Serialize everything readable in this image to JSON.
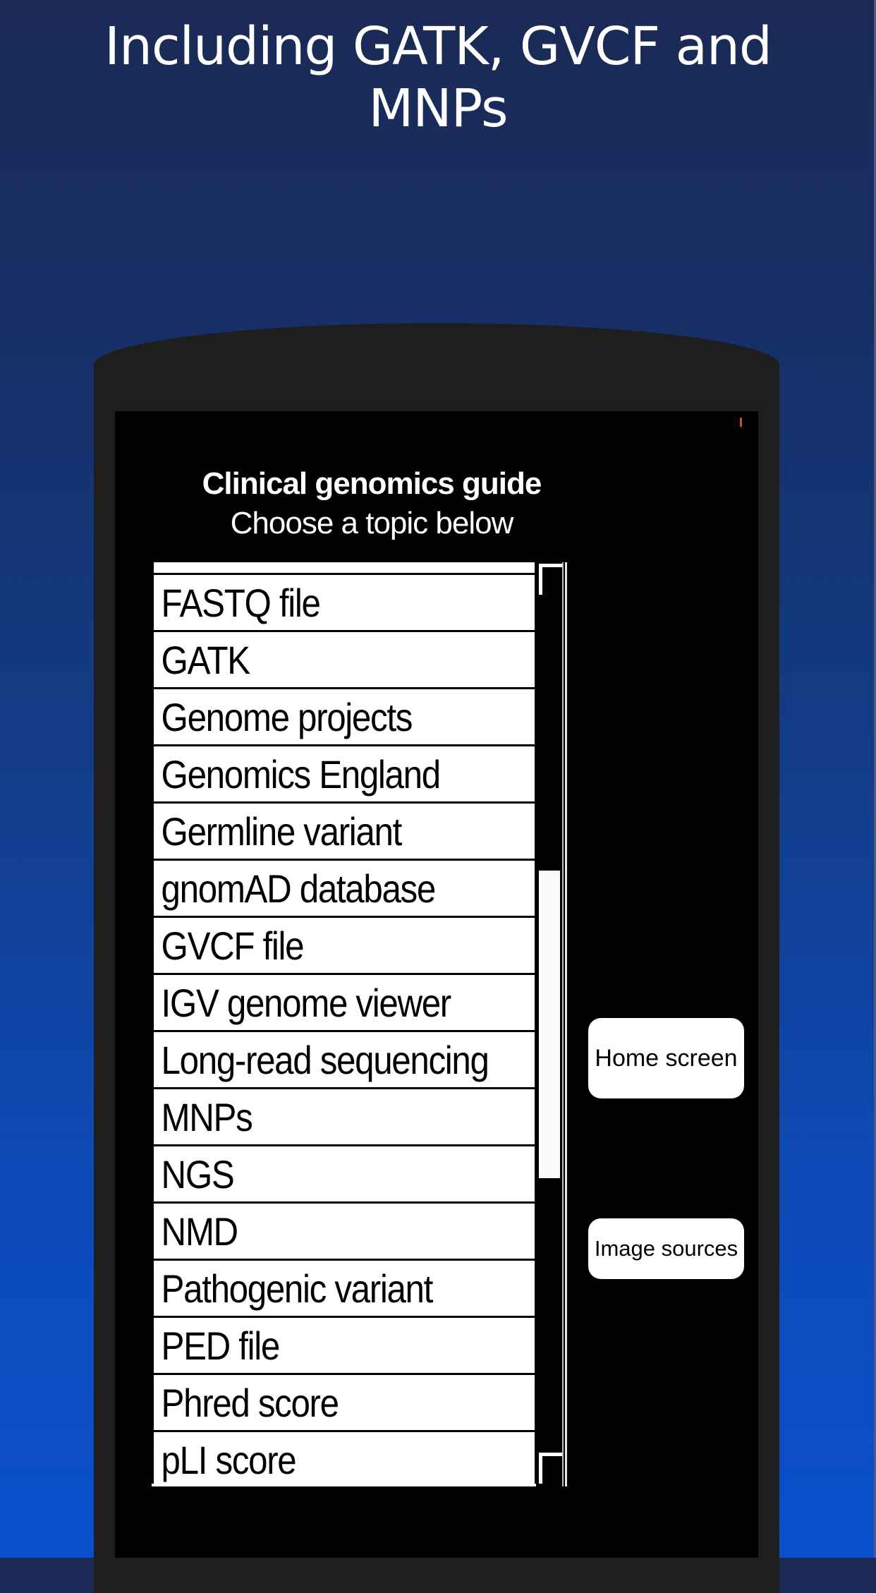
{
  "promo": {
    "headline_line1": "Including GATK, GVCF and",
    "headline_line2": "MNPs"
  },
  "app": {
    "title": "Clinical genomics guide",
    "subtitle": "Choose a topic below"
  },
  "topic_list": {
    "items": [
      "",
      "FASTQ file",
      "GATK",
      "Genome projects",
      "Genomics England",
      "Germline variant",
      "gnomAD database",
      "GVCF file",
      "IGV genome viewer",
      "Long-read sequencing",
      "MNPs",
      "NGS",
      "NMD",
      "Pathogenic variant",
      "PED file",
      "Phred score",
      "pLI score"
    ],
    "scroll_position": 0.5,
    "visible_fraction": 0.36
  },
  "buttons": {
    "home_label": "Home screen",
    "sources_label": "Image sources"
  },
  "icons": {
    "scroll_up": "scroll-up-arrow",
    "scroll_down": "scroll-down-arrow"
  },
  "colors": {
    "background_top": "#1b2a55",
    "background_bottom": "#0a50cc",
    "phone_frame": "#1e1e1e",
    "screen": "#000000",
    "status_indicator": "#d9462f"
  }
}
